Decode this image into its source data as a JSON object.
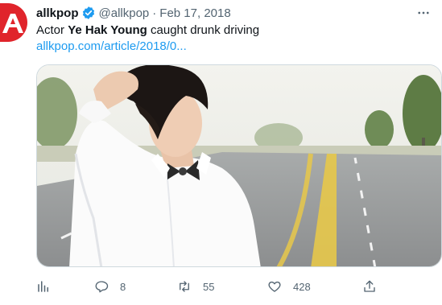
{
  "tweet": {
    "author_name": "allkpop",
    "handle": "@allkpop",
    "separator": "·",
    "date": "Feb 17, 2018",
    "text_prefix": "Actor ",
    "text_bold": "Ye Hak Young",
    "text_suffix": " caught drunk driving",
    "link": "allkpop.com/article/2018/0..."
  },
  "actions": {
    "replies": "8",
    "retweets": "55",
    "likes": "428"
  },
  "icons": [
    "allkpop-logo-icon",
    "verified-badge-icon",
    "more-icon",
    "analytics-icon",
    "reply-icon",
    "retweet-icon",
    "like-icon",
    "share-icon"
  ],
  "colors": {
    "accent": "#1d9bf0",
    "text": "#0f1419",
    "muted": "#536471",
    "brand": "#e0242b"
  }
}
